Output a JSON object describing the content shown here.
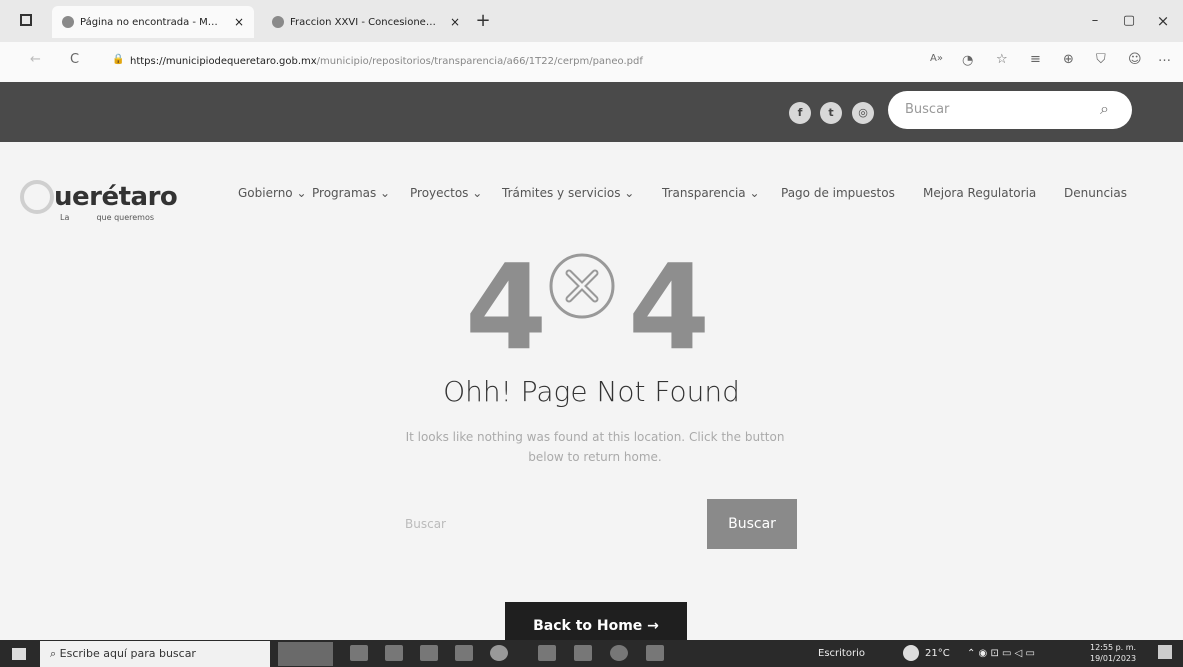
{
  "browser": {
    "tabs": [
      {
        "title": "Página no encontrada - Municip",
        "close": "×"
      },
      {
        "title": "Fraccion XXVI - Concesiones, con",
        "close": "×"
      }
    ],
    "new_tab": "+",
    "window_controls": {
      "minimize": "–",
      "maximize": "▢",
      "close": "×"
    },
    "url_domain": "https://municipiodequeretaro.gob.mx",
    "url_path": "/municipio/repositorios/transparencia/a66/1T22/cerpm/paneo.pdf",
    "reload": "C"
  },
  "site": {
    "social": [
      "f",
      "t",
      "◎"
    ],
    "top_search_placeholder": "Buscar",
    "logo": {
      "text": "uerétaro",
      "tagline_pre": "La",
      "tagline_post": "que queremos"
    },
    "nav": [
      "Gobierno ⌄",
      "Programas ⌄",
      "Proyectos ⌄",
      "Trámites y servicios ⌄",
      "Transparencia ⌄",
      "Pago de impuestos",
      "Mejora Regulatoria",
      "Denuncias"
    ]
  },
  "error": {
    "digit_left": "4",
    "digit_right": "4",
    "title": "Ohh! Page Not Found",
    "description": "It looks like nothing was found at this location. Click the button below to return home.",
    "search_placeholder": "Buscar",
    "search_button": "Buscar",
    "back_button": "Back to Home →"
  },
  "taskbar": {
    "search_placeholder": "Escribe aquí para buscar",
    "desktop_label": "Escritorio",
    "weather": "21°C",
    "time": "12:55 p. m.",
    "date": "19/01/2023"
  }
}
